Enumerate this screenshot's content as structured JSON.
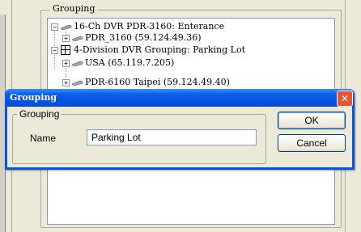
{
  "background": {
    "group_title": "Grouping",
    "tree": [
      {
        "label": "16-Ch DVR PDR-3160: Enterance",
        "icon": "camera-icon",
        "expander": "−"
      },
      {
        "label": "PDR_3160 (59.124.49.36)",
        "icon": "camera-icon",
        "expander": "+"
      },
      {
        "label": "4-Division DVR Grouping: Parking Lot",
        "icon": "grid-icon",
        "expander": "−"
      },
      {
        "label": "USA (65.119.7.205)",
        "icon": "camera-icon",
        "expander": "+"
      },
      {
        "label": "PDR-6160 Taipei (59.124.49.40)",
        "icon": "camera-icon",
        "expander": "+"
      }
    ]
  },
  "dialog": {
    "title": "Grouping",
    "close_glyph": "✕",
    "group_label": "Grouping",
    "name_label": "Name",
    "name_value": "Parking Lot",
    "ok_label": "OK",
    "cancel_label": "Cancel"
  },
  "colors": {
    "titlebar": "#0a5fe6",
    "close": "#e65432",
    "window_bg": "#ece9d8"
  }
}
